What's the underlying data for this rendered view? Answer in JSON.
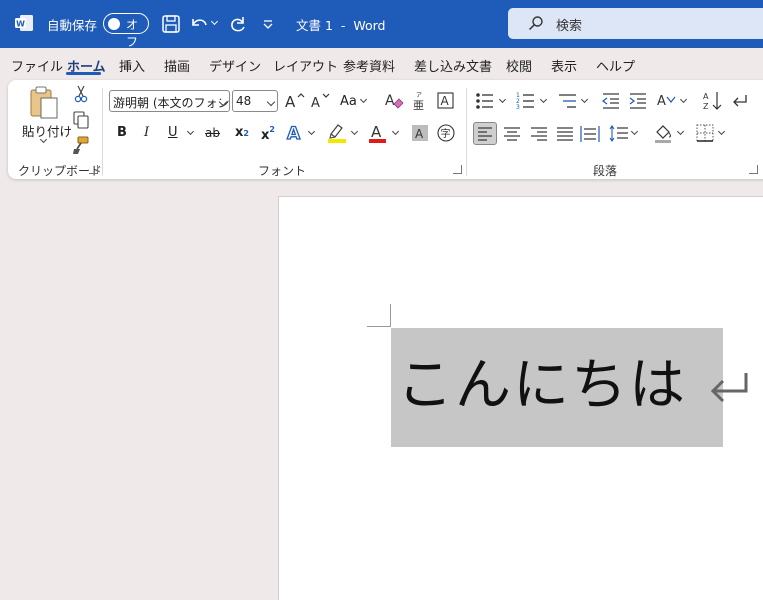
{
  "titlebar": {
    "autosave_label": "自動保存",
    "autosave_state": "オフ",
    "doc_title": "文書 1  -  Word",
    "search_placeholder": "検索"
  },
  "menu": {
    "tabs": [
      "ファイル",
      "ホーム",
      "挿入",
      "描画",
      "デザイン",
      "レイアウト",
      "参考資料",
      "差し込み文書",
      "校閲",
      "表示",
      "ヘルプ"
    ],
    "active_tab": "ホーム"
  },
  "ribbon": {
    "clipboard": {
      "paste_label": "貼り付け",
      "group_label": "クリップボード"
    },
    "font": {
      "font_name": "游明朝 (本文のフォン",
      "font_size": "48",
      "change_case_label": "Aa",
      "bold": "B",
      "italic": "I",
      "underline": "U",
      "strikethrough": "ab",
      "subscript": "x",
      "superscript": "x",
      "group_label": "フォント"
    },
    "paragraph": {
      "group_label": "段落"
    },
    "colors": {
      "highlight": "#f5e800",
      "font_color": "#e01b1b",
      "accent": "#1f5bb8"
    }
  },
  "document": {
    "text": "こんにちは"
  }
}
